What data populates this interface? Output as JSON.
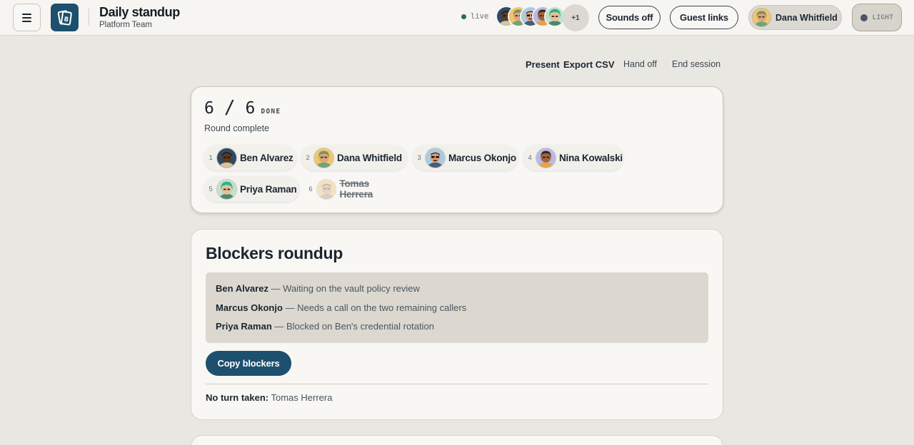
{
  "header": {
    "title": "Daily standup",
    "subtitle": "Platform Team",
    "live_label": "live",
    "more_count": "+1",
    "sounds_label": "Sounds off",
    "guest_label": "Guest links",
    "user_name": "Dana Whitfield",
    "theme_label": "LIGHT"
  },
  "toolbar": {
    "present": "Present",
    "export": "Export CSV",
    "handoff": "Hand off",
    "end": "End session"
  },
  "round": {
    "done_count": "6",
    "total_count": "6",
    "done_label": "DONE",
    "status": "Round complete",
    "participants": [
      {
        "num": "1",
        "name": "Ben Alvarez"
      },
      {
        "num": "2",
        "name": "Dana Whitfield"
      },
      {
        "num": "3",
        "name": "Marcus Okonjo"
      },
      {
        "num": "4",
        "name": "Nina Kowalski"
      },
      {
        "num": "5",
        "name": "Priya Raman"
      },
      {
        "num": "6",
        "name": "Tomas Herrera"
      }
    ]
  },
  "blockers": {
    "title": "Blockers roundup",
    "items": [
      {
        "who": "Ben Alvarez",
        "text": " — Waiting on the vault policy review"
      },
      {
        "who": "Marcus Okonjo",
        "text": " — Needs a call on the two remaining callers"
      },
      {
        "who": "Priya Raman",
        "text": " — Blocked on Ben's credential rotation"
      }
    ],
    "copy_label": "Copy blockers",
    "no_turn_label": "No turn taken:",
    "no_turn_names": " Tomas Herrera"
  },
  "colors": {
    "accent": "#1d4f6e",
    "background": "#e9e7e1",
    "card": "#f8f7f3",
    "live_dot": "#2c6a49"
  }
}
